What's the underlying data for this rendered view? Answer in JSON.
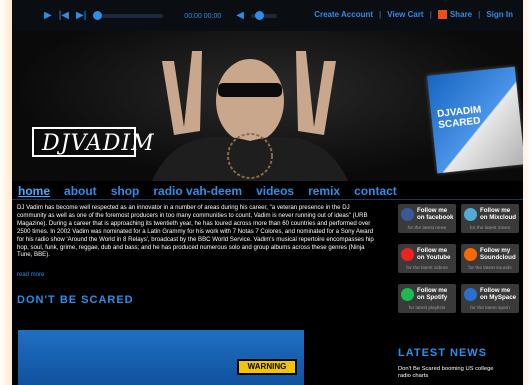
{
  "player": {
    "time": "00:00 00:00"
  },
  "top_links": {
    "create_account": "Create Account",
    "view_cart": "View Cart",
    "share": "Share",
    "sign_in": "Sign In"
  },
  "hero": {
    "logo_text": "DJVADIM",
    "album_title": "DJVADIM SCARED"
  },
  "nav": {
    "home": "home",
    "about": "about",
    "shop": "shop",
    "radio": "radio vah-deem",
    "videos": "videos",
    "remix": "remix",
    "contact": "contact"
  },
  "bio": {
    "text": "DJ Vadim has become well respected as an innovator in a number of areas during his career, \"a veteran presence in the DJ community as well as one of the foremost producers in too many communities to count, Vadim is never running out of ideas\" (URB Magazine). During a career that is approaching its twentieth year, he has toured across more than 60 countries and performed over 2500 times. In 2002 Vadim was nominated for a Latin Grammy for his work with 7 Notas 7 Colores, and nominated for a Sony Award for his radio show 'Around the World in 8 Relays', broadcast by the BBC World Service. Vadim's musical repertoire encompasses hip hop, soul, funk, grime, reggae, dub and bass; and he has produced numerous solo and group albums across these genres (Ninja Tune, BBE).",
    "read_more": "read more"
  },
  "section": {
    "dont_be_scared": "DON'T BE SCARED",
    "warning": "WARNING"
  },
  "social": [
    {
      "title": "Follow me on facebook",
      "sub": "for the latest news",
      "icon": "facebook-icon",
      "color": "#3b5998"
    },
    {
      "title": "Follow me on Mixcloud",
      "sub": "for the latest mixes",
      "icon": "mixcloud-icon",
      "color": "#52aad8"
    },
    {
      "title": "Follow me on Youtube",
      "sub": "for the latest videos",
      "icon": "youtube-icon",
      "color": "#e22"
    },
    {
      "title": "Follow my Soundcloud",
      "sub": "for the latest sounds",
      "icon": "soundcloud-icon",
      "color": "#f60"
    },
    {
      "title": "Follow me on Spotify",
      "sub": "for latest playlists",
      "icon": "spotify-icon",
      "color": "#1db954"
    },
    {
      "title": "Follow me on MySpace",
      "sub": "for the latest spam",
      "icon": "myspace-icon",
      "color": "#2a6ed0"
    }
  ],
  "latest": {
    "heading": "LATEST NEWS",
    "item": "Don't Be Scared booming US college radio charts"
  }
}
